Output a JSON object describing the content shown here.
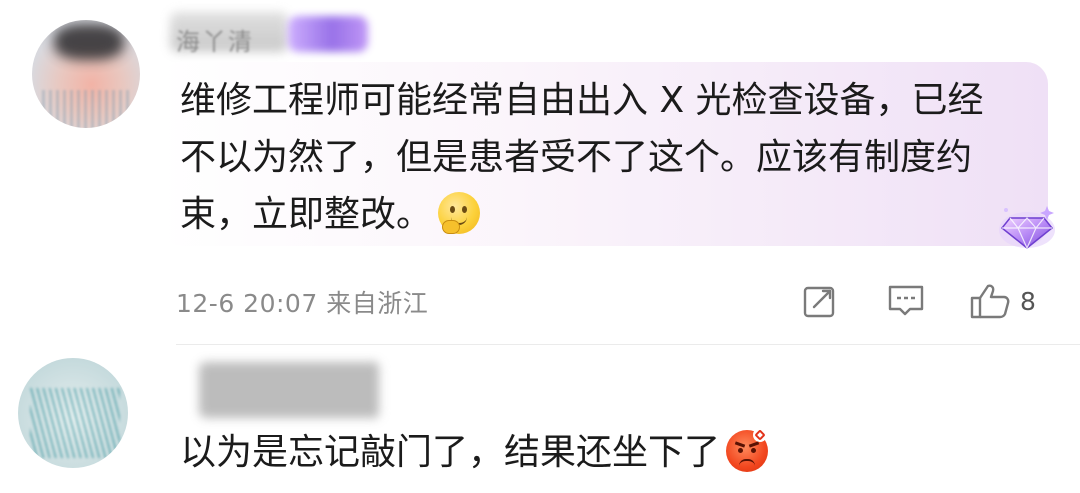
{
  "comments": [
    {
      "username": "海丫清",
      "text_lines": [
        "维修工程师可能经常自由出入 X 光检查设备，已经",
        "不以为然了，但是患者受不了这个。应该有制度约",
        "束，立即整改。"
      ],
      "emoji": "smiling-face-with-hand-over-mouth",
      "timestamp": "12-6 20:07",
      "location": "来自浙江",
      "like_count": "8"
    },
    {
      "text": "以为是忘记敲门了，结果还坐下了",
      "emoji": "angry-face"
    }
  ],
  "icons": {
    "edit": "edit-icon",
    "reply": "reply-icon",
    "like": "thumbs-up-icon",
    "badge": "gem-badge-icon"
  },
  "colors": {
    "bubble_gradient_end": "#efe0f6",
    "meta_text": "#8a8a8a",
    "badge_purple": "#8e63e6"
  }
}
